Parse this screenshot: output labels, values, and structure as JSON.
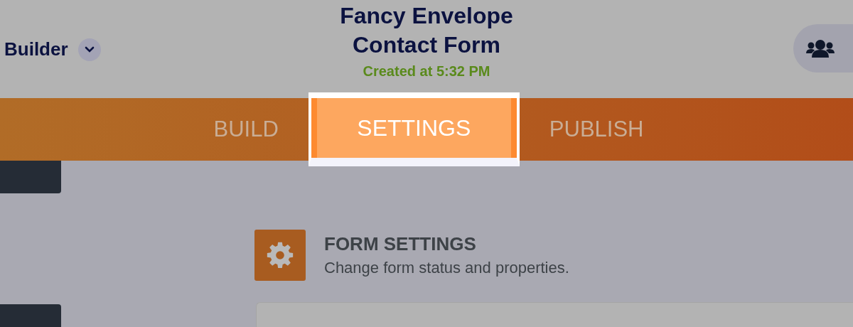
{
  "header": {
    "app_menu": {
      "label": "Builder"
    },
    "title": "Fancy Envelope Contact Form",
    "subtitle": "Created at 5:32 PM"
  },
  "tabs": [
    {
      "label": "BUILD",
      "selected": false
    },
    {
      "label": "SETTINGS",
      "selected": true
    },
    {
      "label": "PUBLISH",
      "selected": false
    }
  ],
  "section": {
    "title": "FORM SETTINGS",
    "description": "Change form status and properties."
  }
}
